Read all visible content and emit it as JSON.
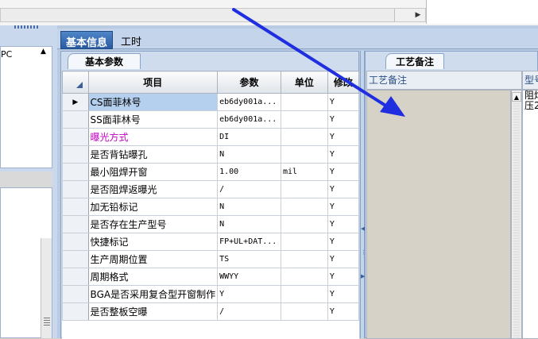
{
  "left_panel": {
    "list_item": "PC"
  },
  "tabs": [
    {
      "label": "基本信息",
      "active": true
    },
    {
      "label": "工时",
      "active": false
    }
  ],
  "params": {
    "tab_label": "基本参数",
    "columns": [
      "项目",
      "参数",
      "单位",
      "修改"
    ],
    "rows": [
      {
        "item": "CS面菲林号",
        "param": "eb6dy001a...",
        "unit": "",
        "check": "Y",
        "selected": true,
        "highlight": false
      },
      {
        "item": "SS面菲林号",
        "param": "eb6dy001a...",
        "unit": "",
        "check": "Y",
        "selected": false,
        "highlight": false
      },
      {
        "item": "曝光方式",
        "param": "DI",
        "unit": "",
        "check": "Y",
        "selected": false,
        "highlight": true
      },
      {
        "item": "是否背钻曝孔",
        "param": "N",
        "unit": "",
        "check": "Y",
        "selected": false,
        "highlight": false
      },
      {
        "item": "最小阻焊开窗",
        "param": "1.00",
        "unit": "mil",
        "check": "Y",
        "selected": false,
        "highlight": false
      },
      {
        "item": "是否阻焊返曝光",
        "param": "/",
        "unit": "",
        "check": "Y",
        "selected": false,
        "highlight": false
      },
      {
        "item": "加无铅标记",
        "param": "N",
        "unit": "",
        "check": "Y",
        "selected": false,
        "highlight": false
      },
      {
        "item": "是否存在生产型号",
        "param": "N",
        "unit": "",
        "check": "Y",
        "selected": false,
        "highlight": false
      },
      {
        "item": "快捷标记",
        "param": "FP+UL+DAT...",
        "unit": "",
        "check": "Y",
        "selected": false,
        "highlight": false
      },
      {
        "item": "生产周期位置",
        "param": "TS",
        "unit": "",
        "check": "Y",
        "selected": false,
        "highlight": false
      },
      {
        "item": "周期格式",
        "param": "WWYY",
        "unit": "",
        "check": "Y",
        "selected": false,
        "highlight": false
      },
      {
        "item": "BGA是否采用复合型开窗制作",
        "param": "Y",
        "unit": "",
        "check": "Y",
        "selected": false,
        "highlight": false
      },
      {
        "item": "是否整板空曝",
        "param": "/",
        "unit": "",
        "check": "Y",
        "selected": false,
        "highlight": false
      }
    ]
  },
  "notes": {
    "tab_label": "工艺备注",
    "column_header": "工艺备注",
    "model_header": "型号",
    "model_text_line1": "阻焊",
    "model_text_line2": "压2"
  },
  "colors": {
    "highlight_text": "#c000c0",
    "arrow": "#1f2fe0"
  }
}
